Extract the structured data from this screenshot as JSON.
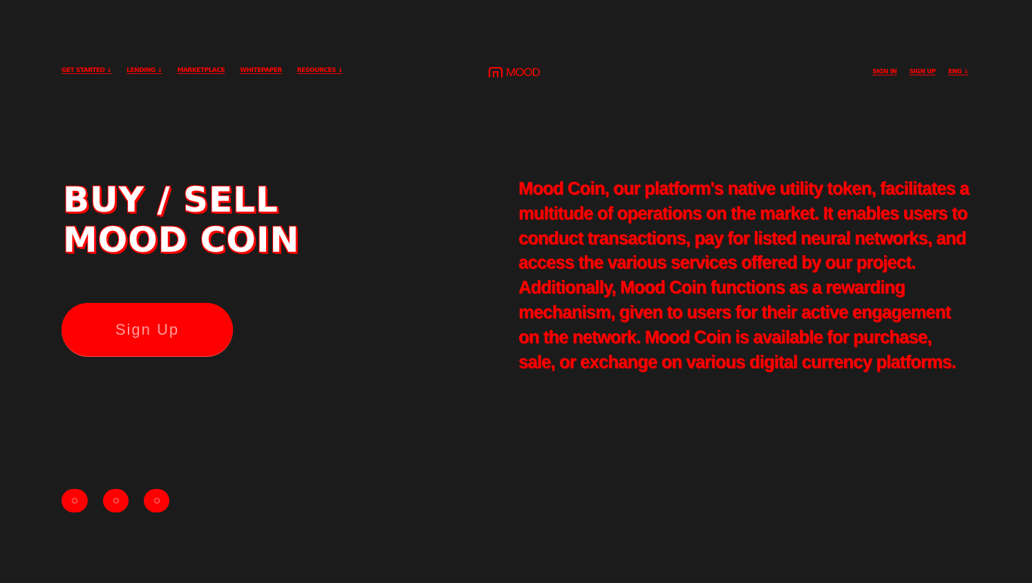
{
  "header": {
    "nav_left": [
      {
        "label": "GET STARTED ↓"
      },
      {
        "label": "LENDING ↓"
      },
      {
        "label": "MARKETPLACE"
      },
      {
        "label": "WHITEPAPER"
      },
      {
        "label": "RESOURCES ↓"
      }
    ],
    "logo": {
      "text": "MOOD",
      "icon": "mood-logo-icon"
    },
    "nav_right": [
      {
        "label": "SIGN IN"
      },
      {
        "label": "SIGN UP"
      },
      {
        "label": "ENG ↓"
      }
    ]
  },
  "hero": {
    "title_line1": "BUY / SELL",
    "title_line2": "MOOD COIN",
    "cta_label": "Sign Up",
    "description": "Mood Coin, our platform's native utility token, facilitates a multitude of operations on the market. It enables users to conduct transactions, pay for listed neural networks, and access the various services offered by our project. Additionally, Mood Coin functions as a rewarding mechanism, given to users for their active engagement on the network. Mood Coin is available for purchase, sale, or exchange on various digital currency platforms."
  },
  "socials": [
    {
      "icon": "telegram-icon"
    },
    {
      "icon": "twitter-icon"
    },
    {
      "icon": "discord-icon"
    }
  ],
  "colors": {
    "background": "#1b1b1b",
    "accent": "#ff0000",
    "title_fill": "#ffffff"
  }
}
